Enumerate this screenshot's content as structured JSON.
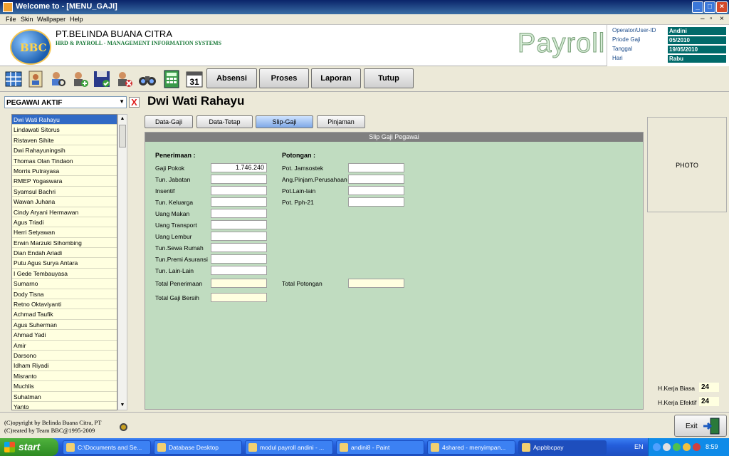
{
  "window": {
    "title": "Welcome to - [MENU_GAJI]"
  },
  "menu": [
    "File",
    "Skin",
    "Wallpaper",
    "Help"
  ],
  "header": {
    "logo_text": "BBC",
    "company": "PT.BELINDA BUANA CITRA",
    "subtitle": "HRD & PAYROLL - MANAGEMENT INFORMATION SYSTEMS",
    "app_name": "Payroll"
  },
  "info": [
    {
      "label": "Operator/User-ID",
      "value": "Andini"
    },
    {
      "label": "Priode Gaji",
      "value": "05/2010"
    },
    {
      "label": "Tanggal",
      "value": "19/05/2010"
    },
    {
      "label": "Hari",
      "value": "Rabu"
    }
  ],
  "toolbar": {
    "calendar_day": "31",
    "buttons": [
      "Absensi",
      "Proses",
      "Laporan",
      "Tutup"
    ]
  },
  "filter": {
    "value": "PEGAWAI AKTIF"
  },
  "employees": [
    "Dwi Wati Rahayu",
    "Lindawati Sitorus",
    "Ristaven Sihite",
    "Dwi Rahayuningsih",
    "Thomas Olan Tindaon",
    "Morris Putrayasa",
    "RMEP Yogaswara",
    "Syamsul Bachri",
    "Wawan Juhana",
    "Cindy Aryani Hermawan",
    "Agus Triadi",
    "Herri Setyawan",
    "Erwin Marzuki Sihombing",
    "Dian Endah Ariadi",
    "Putu Agus Surya Antara",
    "I Gede Tembauyasa",
    "Sumarno",
    "Dody Tisna",
    "Retno Oktaviyanti",
    "Achmad Taufik",
    "Agus Suherman",
    "Ahmad Yadi",
    "Amir",
    "Darsono",
    "Idham Riyadi",
    "Misranto",
    "Muchlis",
    "Suhatman",
    "Yanto"
  ],
  "selected_employee": "Dwi Wati Rahayu",
  "tabs": [
    "Data-Gaji",
    "Data-Tetap",
    "Slip-Gaji",
    "Pinjaman"
  ],
  "active_tab": "Slip-Gaji",
  "slip": {
    "header": "Slip Gaji Pegawai",
    "penerimaan_title": "Penerimaan :",
    "potongan_title": "Potongan :",
    "penerimaan": [
      {
        "label": "Gaji Pokok",
        "value": "1.746.240"
      },
      {
        "label": "Tun. Jabatan",
        "value": ""
      },
      {
        "label": "Insentif",
        "value": ""
      },
      {
        "label": "Tun. Keluarga",
        "value": ""
      },
      {
        "label": "Uang Makan",
        "value": ""
      },
      {
        "label": "Uang Transport",
        "value": ""
      },
      {
        "label": "Uang Lembur",
        "value": ""
      },
      {
        "label": "Tun.Sewa Rumah",
        "value": ""
      },
      {
        "label": "Tun.Premi Asuransi",
        "value": ""
      },
      {
        "label": "Tun. Lain-Lain",
        "value": ""
      }
    ],
    "potongan": [
      {
        "label": "Pot. Jamsostek",
        "value": ""
      },
      {
        "label": "Ang.Pinjam.Perusahaan",
        "value": ""
      },
      {
        "label": "Pot.Lain-lain",
        "value": ""
      },
      {
        "label": "Pot. Pph-21",
        "value": ""
      }
    ],
    "total_penerimaan": {
      "label": "Total Penerimaan",
      "value": ""
    },
    "total_potongan": {
      "label": "Total Potongan",
      "value": ""
    },
    "total_gaji_bersih": {
      "label": "Total Gaji Bersih",
      "value": ""
    }
  },
  "photo_label": "PHOTO",
  "kerja": [
    {
      "label": "H.Kerja Biasa",
      "value": "24"
    },
    {
      "label": "H.Kerja Efektif",
      "value": "24"
    }
  ],
  "footer": {
    "copyright": "(C)opyright by Belinda Buana Citra, PT",
    "created": "(C)reated by Team BBC@1995-2009",
    "exit": "Exit"
  },
  "taskbar": {
    "start": "start",
    "tasks": [
      "C:\\Documents and Se...",
      "Database Desktop",
      "modul payroll andini - ...",
      "andini8 - Paint",
      "4shared - menyimpan...",
      "Appbbcpay"
    ],
    "lang": "EN",
    "clock": "8:59"
  }
}
